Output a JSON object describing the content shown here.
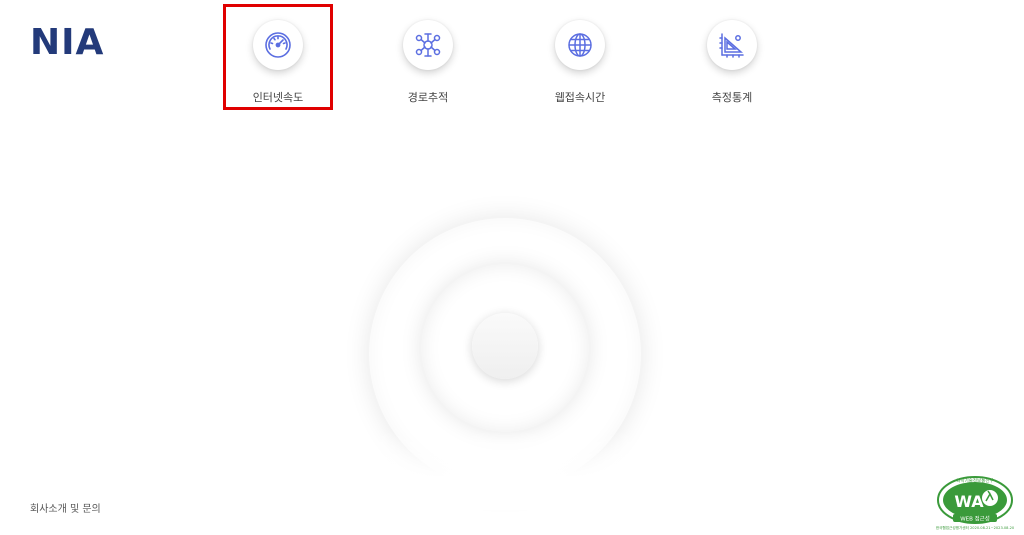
{
  "logo": {
    "text": "NIA"
  },
  "nav": {
    "items": [
      {
        "label": "인터넷속도",
        "icon": "speedometer-icon"
      },
      {
        "label": "경로추적",
        "icon": "route-trace-icon"
      },
      {
        "label": "웹접속시간",
        "icon": "globe-icon"
      },
      {
        "label": "측정통계",
        "icon": "statistics-icon"
      }
    ]
  },
  "footer": {
    "about_label": "회사소개 및 문의"
  },
  "badge": {
    "mark": "WA",
    "top_text": "과학기술정보통신부",
    "main_text": "WEB 접근성",
    "bottom_text": "한국웹접근성평가센터 2020.08.21~2023.08.20"
  },
  "colors": {
    "logo": "#233a7a",
    "icon_stroke": "#5b6ee1",
    "highlight_border": "#e00000",
    "badge_green": "#3a9a3a"
  }
}
